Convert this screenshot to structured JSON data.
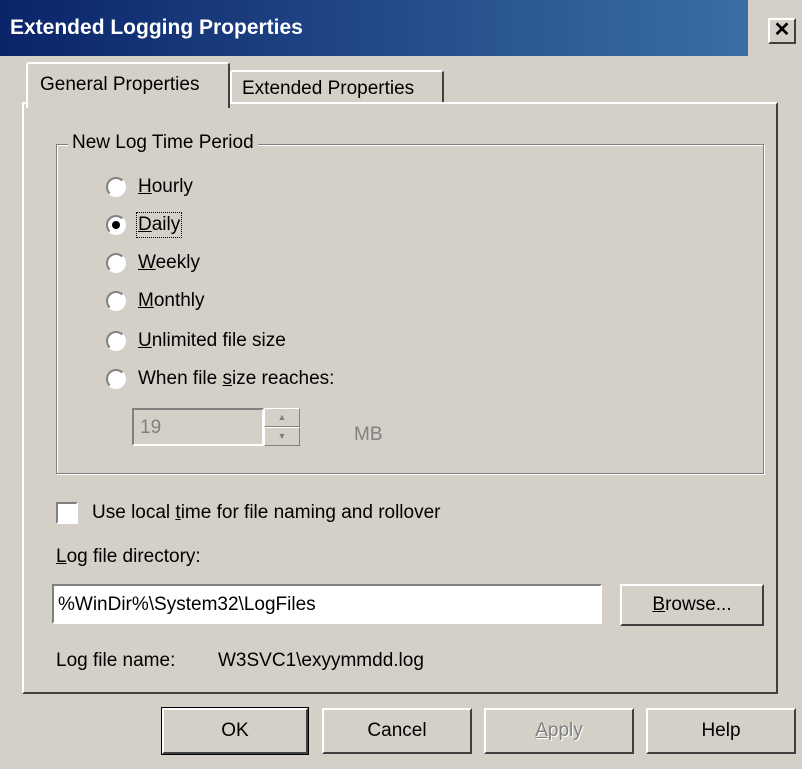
{
  "window": {
    "title": "Extended Logging Properties",
    "close_glyph": "✕"
  },
  "tabs": [
    {
      "label": "General Properties",
      "selected": true
    },
    {
      "label": "Extended Properties",
      "selected": false
    }
  ],
  "log_period": {
    "legend": "New Log Time Period",
    "options": [
      {
        "pre": "",
        "key": "H",
        "post": "ourly",
        "checked": false
      },
      {
        "pre": "",
        "key": "D",
        "post": "aily",
        "checked": true
      },
      {
        "pre": "",
        "key": "W",
        "post": "eekly",
        "checked": false
      },
      {
        "pre": "",
        "key": "M",
        "post": "onthly",
        "checked": false
      },
      {
        "pre": "",
        "key": "U",
        "post": "nlimited file size",
        "checked": false
      },
      {
        "pre": "When file ",
        "key": "s",
        "post": "ize reaches:",
        "checked": false
      }
    ],
    "size_value": "19",
    "size_unit": "MB"
  },
  "local_time": {
    "pre": "Use local ",
    "key": "t",
    "post": "ime for file naming and rollover",
    "checked": false
  },
  "log_directory": {
    "key": "L",
    "label_rest": "og file directory:",
    "value": "%WinDir%\\System32\\LogFiles",
    "browse_key": "B",
    "browse_rest": "rowse..."
  },
  "log_file_name": {
    "label": "Log file name:",
    "value": "W3SVC1\\exyymmdd.log"
  },
  "buttons": {
    "ok": "OK",
    "cancel": "Cancel",
    "apply_key": "A",
    "apply_rest": "pply",
    "help": "Help"
  },
  "colors": {
    "face": "#d4d0c8",
    "title_start": "#0a246a",
    "title_end": "#3a6ea5",
    "disabled": "#808080"
  }
}
